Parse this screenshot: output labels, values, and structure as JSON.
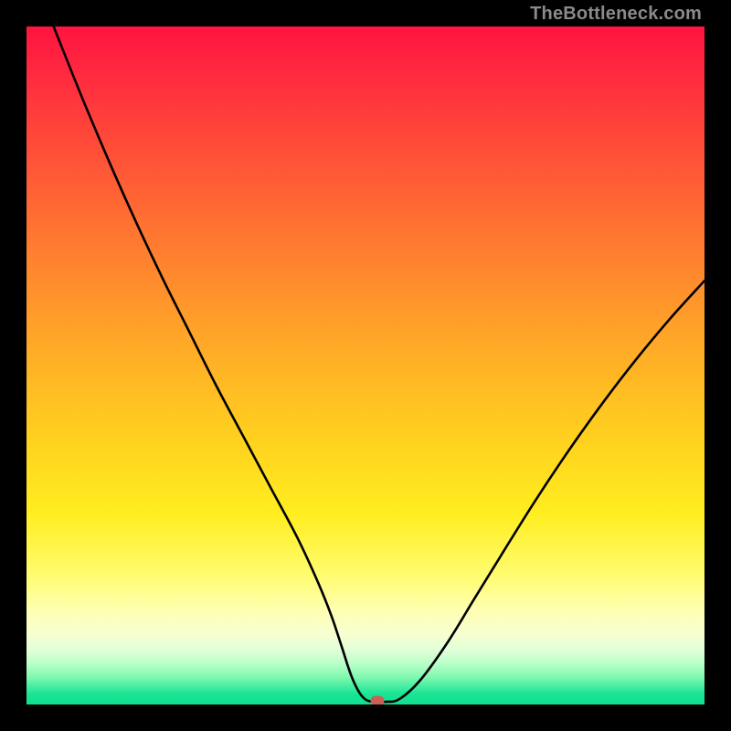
{
  "watermark": "TheBottleneck.com",
  "chart_data": {
    "type": "line",
    "title": "",
    "xlabel": "",
    "ylabel": "",
    "xlim": [
      0,
      100
    ],
    "ylim": [
      0,
      100
    ],
    "series": [
      {
        "name": "bottleneck-curve",
        "x": [
          4,
          8,
          12,
          16,
          20,
          24,
          28,
          32,
          36,
          40,
          43,
          45,
          46.5,
          48,
          49.5,
          51,
          53,
          55,
          58,
          62,
          66,
          70,
          75,
          80,
          85,
          90,
          95,
          100
        ],
        "values": [
          100,
          90,
          80.5,
          71.5,
          63,
          55,
          47,
          39.5,
          32,
          24.5,
          18,
          13,
          8.5,
          4,
          1.2,
          0.4,
          0.4,
          0.8,
          3.5,
          9,
          15.5,
          22,
          30,
          37.5,
          44.5,
          51,
          57,
          62.5
        ]
      }
    ],
    "marker": {
      "x": 51.8,
      "y": 0.5,
      "color": "#c86058"
    },
    "gradient_stops": [
      {
        "pct": 0,
        "color": "#ff1440"
      },
      {
        "pct": 50,
        "color": "#ffb824"
      },
      {
        "pct": 80,
        "color": "#fffc70"
      },
      {
        "pct": 100,
        "color": "#10e090"
      }
    ]
  }
}
